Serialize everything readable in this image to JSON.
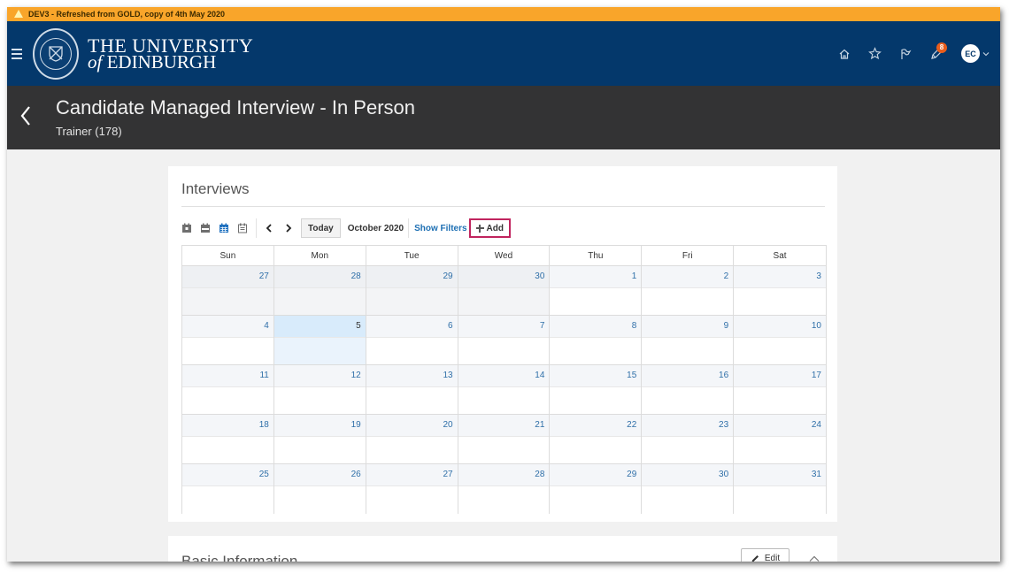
{
  "env_banner": "DEV3 - Refreshed from GOLD, copy of 4th May 2020",
  "brand": {
    "line1": "THE UNIVERSITY",
    "of": "of",
    "line2": "EDINBURGH"
  },
  "header_icons": [
    "home-icon",
    "star-icon",
    "flag-icon",
    "notifications-icon"
  ],
  "notifications": {
    "count": "8"
  },
  "user": {
    "initials": "EC"
  },
  "page": {
    "title": "Candidate Managed Interview - In Person",
    "subtitle": "Trainer (178)"
  },
  "interviews": {
    "title": "Interviews",
    "toolbar": {
      "today_label": "Today",
      "month_label": "October 2020",
      "show_filters_label": "Show Filters",
      "add_label": "Add"
    },
    "weekdays": [
      "Sun",
      "Mon",
      "Tue",
      "Wed",
      "Thu",
      "Fri",
      "Sat"
    ],
    "weeks": [
      [
        "27",
        "28",
        "29",
        "30",
        "1",
        "2",
        "3"
      ],
      [
        "4",
        "5",
        "6",
        "7",
        "8",
        "9",
        "10"
      ],
      [
        "11",
        "12",
        "13",
        "14",
        "15",
        "16",
        "17"
      ],
      [
        "18",
        "19",
        "20",
        "21",
        "22",
        "23",
        "24"
      ],
      [
        "25",
        "26",
        "27",
        "28",
        "29",
        "30",
        "31"
      ]
    ]
  },
  "basic_info": {
    "title": "Basic Information",
    "edit_label": "Edit"
  },
  "colors": {
    "env_bar": "#f9a52a",
    "header": "#04386b",
    "title_bar": "#333334",
    "link": "#1d6fb3",
    "add_highlight": "#c0245e",
    "notification_badge": "#e95d1c"
  }
}
